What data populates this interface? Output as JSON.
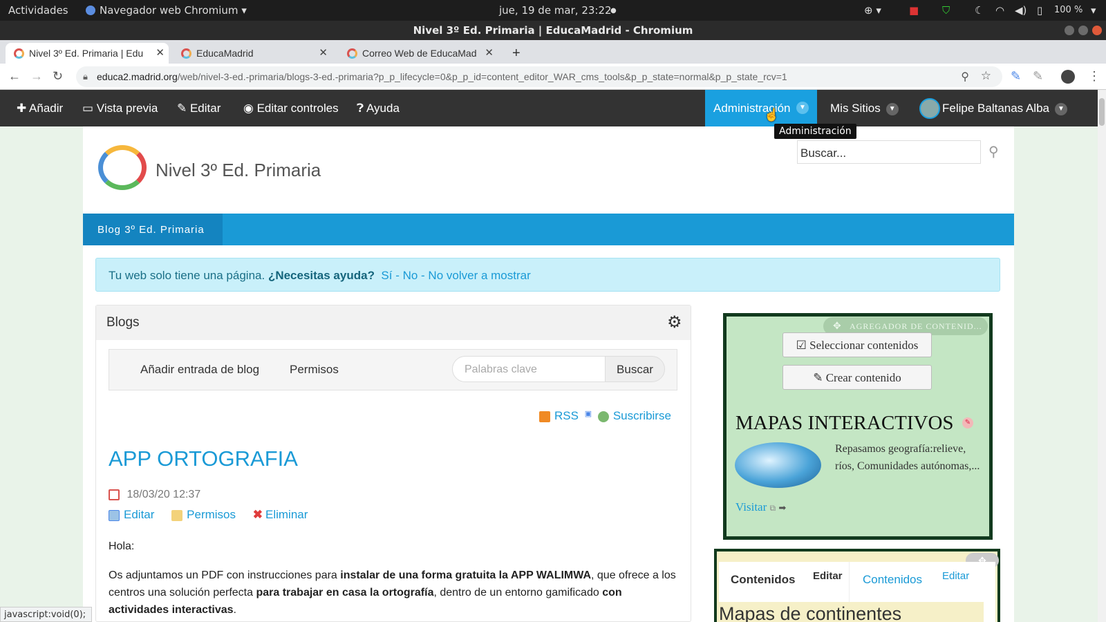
{
  "gnome": {
    "activities": "Actividades",
    "app_name": "Navegador web Chromium",
    "clock": "jue, 19 de mar, 23:22",
    "battery": "100 %"
  },
  "window": {
    "title": "Nivel 3º Ed. Primaria | EducaMadrid - Chromium"
  },
  "tabs": [
    {
      "label": "Nivel 3º Ed. Primaria | Edu"
    },
    {
      "label": "EducaMadrid"
    },
    {
      "label": "Correo Web de EducaMad"
    }
  ],
  "browser": {
    "url_host": "educa2.madrid.org",
    "url_path": "/web/nivel-3-ed.-primaria/blogs-3-ed.-primaria?p_p_lifecycle=0&p_p_id=content_editor_WAR_cms_tools&p_p_state=normal&p_p_state_rcv=1",
    "status": "javascript:void(0);"
  },
  "dockbar": {
    "add": "Añadir",
    "preview": "Vista previa",
    "edit": "Editar",
    "edit_controls": "Editar controles",
    "help": "Ayuda",
    "admin": "Administración",
    "my_sites": "Mis Sitios",
    "user": "Felipe Baltanas Alba",
    "tooltip": "Administración"
  },
  "site": {
    "name": "Nivel 3º Ed. Primaria",
    "search_placeholder": "Buscar...",
    "nav_item": "Blog 3º Ed. Primaria"
  },
  "alert": {
    "text": "Tu web solo tiene una página.",
    "question": "¿Necesitas ayuda?",
    "yes": "Sí",
    "no": "No",
    "never": "No volver a mostrar",
    "sep": " - "
  },
  "blogs": {
    "title": "Blogs",
    "add_entry": "Añadir entrada de blog",
    "permissions": "Permisos",
    "keywords_placeholder": "Palabras clave",
    "search_button": "Buscar",
    "rss": "RSS",
    "subscribe": "Suscribirse",
    "entry": {
      "title": "APP ORTOGRAFIA",
      "date": "18/03/20 12:37",
      "edit": "Editar",
      "permissions": "Permisos",
      "delete": "Eliminar",
      "greeting": "Hola:",
      "p1_a": "Os adjuntamos un PDF con instrucciones para ",
      "p1_b": "instalar de una forma gratuita la APP WALIMWA",
      "p1_c": ", que ofrece a los centros una solución perfecta ",
      "p1_d": "para trabajar en casa la ortografía",
      "p1_e": ", dentro de un entorno gamificado ",
      "p1_f": "con actividades interactivas",
      "p1_g": "."
    }
  },
  "aggregator": {
    "label": "AGREGADOR DE CONTENID...",
    "select": "Seleccionar contenidos",
    "create": "Crear contenido",
    "title": "MAPAS INTERACTIVOS",
    "description": "Repasamos geografía:relieve, ríos, Comunidades autónomas,...",
    "visit": "Visitar"
  },
  "contents_portlet": {
    "tab1": "Contenidos",
    "edit1": "Editar",
    "tab2": "Contenidos",
    "edit2": "Editar",
    "heading": "Mapas de continentes"
  }
}
